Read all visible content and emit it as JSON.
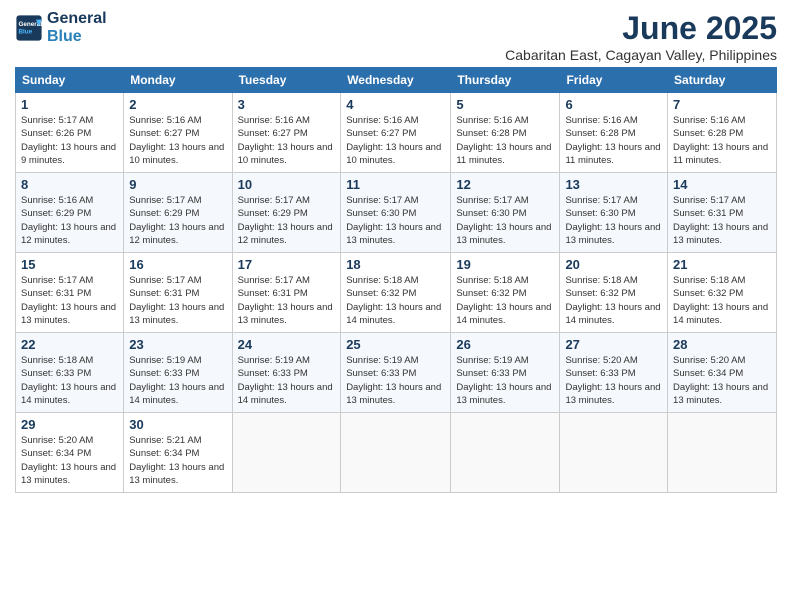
{
  "header": {
    "logo_line1": "General",
    "logo_line2": "Blue",
    "month_title": "June 2025",
    "location": "Cabaritan East, Cagayan Valley, Philippines"
  },
  "weekdays": [
    "Sunday",
    "Monday",
    "Tuesday",
    "Wednesday",
    "Thursday",
    "Friday",
    "Saturday"
  ],
  "weeks": [
    [
      {
        "day": "1",
        "sunrise": "5:17 AM",
        "sunset": "6:26 PM",
        "daylight": "13 hours and 9 minutes."
      },
      {
        "day": "2",
        "sunrise": "5:16 AM",
        "sunset": "6:27 PM",
        "daylight": "13 hours and 10 minutes."
      },
      {
        "day": "3",
        "sunrise": "5:16 AM",
        "sunset": "6:27 PM",
        "daylight": "13 hours and 10 minutes."
      },
      {
        "day": "4",
        "sunrise": "5:16 AM",
        "sunset": "6:27 PM",
        "daylight": "13 hours and 10 minutes."
      },
      {
        "day": "5",
        "sunrise": "5:16 AM",
        "sunset": "6:28 PM",
        "daylight": "13 hours and 11 minutes."
      },
      {
        "day": "6",
        "sunrise": "5:16 AM",
        "sunset": "6:28 PM",
        "daylight": "13 hours and 11 minutes."
      },
      {
        "day": "7",
        "sunrise": "5:16 AM",
        "sunset": "6:28 PM",
        "daylight": "13 hours and 11 minutes."
      }
    ],
    [
      {
        "day": "8",
        "sunrise": "5:16 AM",
        "sunset": "6:29 PM",
        "daylight": "13 hours and 12 minutes."
      },
      {
        "day": "9",
        "sunrise": "5:17 AM",
        "sunset": "6:29 PM",
        "daylight": "13 hours and 12 minutes."
      },
      {
        "day": "10",
        "sunrise": "5:17 AM",
        "sunset": "6:29 PM",
        "daylight": "13 hours and 12 minutes."
      },
      {
        "day": "11",
        "sunrise": "5:17 AM",
        "sunset": "6:30 PM",
        "daylight": "13 hours and 13 minutes."
      },
      {
        "day": "12",
        "sunrise": "5:17 AM",
        "sunset": "6:30 PM",
        "daylight": "13 hours and 13 minutes."
      },
      {
        "day": "13",
        "sunrise": "5:17 AM",
        "sunset": "6:30 PM",
        "daylight": "13 hours and 13 minutes."
      },
      {
        "day": "14",
        "sunrise": "5:17 AM",
        "sunset": "6:31 PM",
        "daylight": "13 hours and 13 minutes."
      }
    ],
    [
      {
        "day": "15",
        "sunrise": "5:17 AM",
        "sunset": "6:31 PM",
        "daylight": "13 hours and 13 minutes."
      },
      {
        "day": "16",
        "sunrise": "5:17 AM",
        "sunset": "6:31 PM",
        "daylight": "13 hours and 13 minutes."
      },
      {
        "day": "17",
        "sunrise": "5:17 AM",
        "sunset": "6:31 PM",
        "daylight": "13 hours and 13 minutes."
      },
      {
        "day": "18",
        "sunrise": "5:18 AM",
        "sunset": "6:32 PM",
        "daylight": "13 hours and 14 minutes."
      },
      {
        "day": "19",
        "sunrise": "5:18 AM",
        "sunset": "6:32 PM",
        "daylight": "13 hours and 14 minutes."
      },
      {
        "day": "20",
        "sunrise": "5:18 AM",
        "sunset": "6:32 PM",
        "daylight": "13 hours and 14 minutes."
      },
      {
        "day": "21",
        "sunrise": "5:18 AM",
        "sunset": "6:32 PM",
        "daylight": "13 hours and 14 minutes."
      }
    ],
    [
      {
        "day": "22",
        "sunrise": "5:18 AM",
        "sunset": "6:33 PM",
        "daylight": "13 hours and 14 minutes."
      },
      {
        "day": "23",
        "sunrise": "5:19 AM",
        "sunset": "6:33 PM",
        "daylight": "13 hours and 14 minutes."
      },
      {
        "day": "24",
        "sunrise": "5:19 AM",
        "sunset": "6:33 PM",
        "daylight": "13 hours and 14 minutes."
      },
      {
        "day": "25",
        "sunrise": "5:19 AM",
        "sunset": "6:33 PM",
        "daylight": "13 hours and 13 minutes."
      },
      {
        "day": "26",
        "sunrise": "5:19 AM",
        "sunset": "6:33 PM",
        "daylight": "13 hours and 13 minutes."
      },
      {
        "day": "27",
        "sunrise": "5:20 AM",
        "sunset": "6:33 PM",
        "daylight": "13 hours and 13 minutes."
      },
      {
        "day": "28",
        "sunrise": "5:20 AM",
        "sunset": "6:34 PM",
        "daylight": "13 hours and 13 minutes."
      }
    ],
    [
      {
        "day": "29",
        "sunrise": "5:20 AM",
        "sunset": "6:34 PM",
        "daylight": "13 hours and 13 minutes."
      },
      {
        "day": "30",
        "sunrise": "5:21 AM",
        "sunset": "6:34 PM",
        "daylight": "13 hours and 13 minutes."
      },
      null,
      null,
      null,
      null,
      null
    ]
  ],
  "labels": {
    "sunrise": "Sunrise:",
    "sunset": "Sunset:",
    "daylight": "Daylight:"
  }
}
